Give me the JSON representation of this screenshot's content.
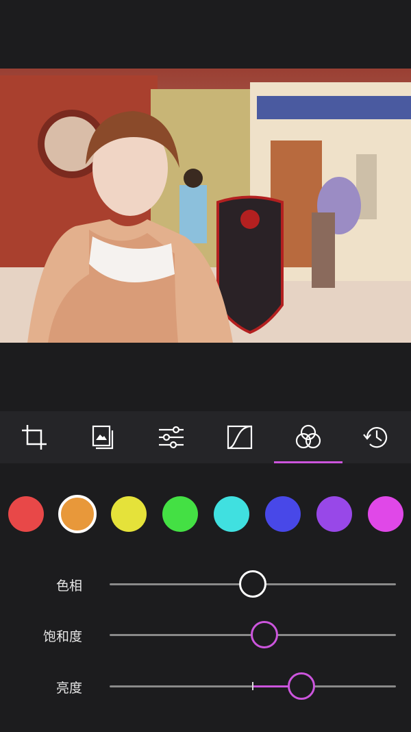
{
  "toolbar": {
    "tools": [
      {
        "name": "crop-icon"
      },
      {
        "name": "filter-layers-icon"
      },
      {
        "name": "adjust-sliders-icon"
      },
      {
        "name": "curves-icon"
      },
      {
        "name": "hsl-color-circles-icon",
        "active": true
      },
      {
        "name": "history-icon"
      }
    ],
    "accent_color": "#cc55dd"
  },
  "swatches": [
    {
      "name": "red",
      "color": "#e84848"
    },
    {
      "name": "orange",
      "color": "#e8983a",
      "selected": true
    },
    {
      "name": "yellow",
      "color": "#e5e23a"
    },
    {
      "name": "green",
      "color": "#44e044"
    },
    {
      "name": "cyan",
      "color": "#40e0e0"
    },
    {
      "name": "blue",
      "color": "#4848e8"
    },
    {
      "name": "purple",
      "color": "#9848e8"
    },
    {
      "name": "magenta",
      "color": "#e048e8"
    }
  ],
  "sliders": [
    {
      "key": "hue",
      "label": "色相",
      "value": 0.5,
      "knob_color": "#ffffff"
    },
    {
      "key": "saturation",
      "label": "饱和度",
      "value": 0.54,
      "knob_color": "#cc55dd"
    },
    {
      "key": "brightness",
      "label": "亮度",
      "value": 0.67,
      "knob_color": "#cc55dd"
    }
  ]
}
